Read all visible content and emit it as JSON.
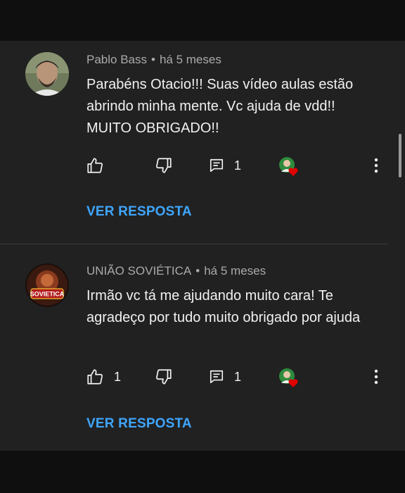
{
  "comments": [
    {
      "author": "Pablo Bass",
      "separator": "•",
      "time": "há 5 meses",
      "text": "Parabéns Otacio!!! Suas vídeo aulas estão abrindo minha mente. Vc ajuda de vdd!! MUITO OBRIGADO!!",
      "likes": "",
      "replies": "1",
      "reply_link": "VER RESPOSTA"
    },
    {
      "author": "UNIÃO SOVIÉTICA",
      "separator": "•",
      "time": "há 5 meses",
      "text": "Irmão vc tá me ajudando muito cara! Te agradeço por tudo muito obrigado por ajuda",
      "likes": "1",
      "replies": "1",
      "reply_link": "VER RESPOSTA",
      "avatar_text": "SOVIETICA"
    }
  ],
  "colors": {
    "background": "#212121",
    "link": "#3ea6ff",
    "meta": "#aaaaaa",
    "heart": "#e00000"
  },
  "icons": [
    "thumbs-up-icon",
    "thumbs-down-icon",
    "reply-icon",
    "creator-heart-icon",
    "more-vert-icon"
  ]
}
